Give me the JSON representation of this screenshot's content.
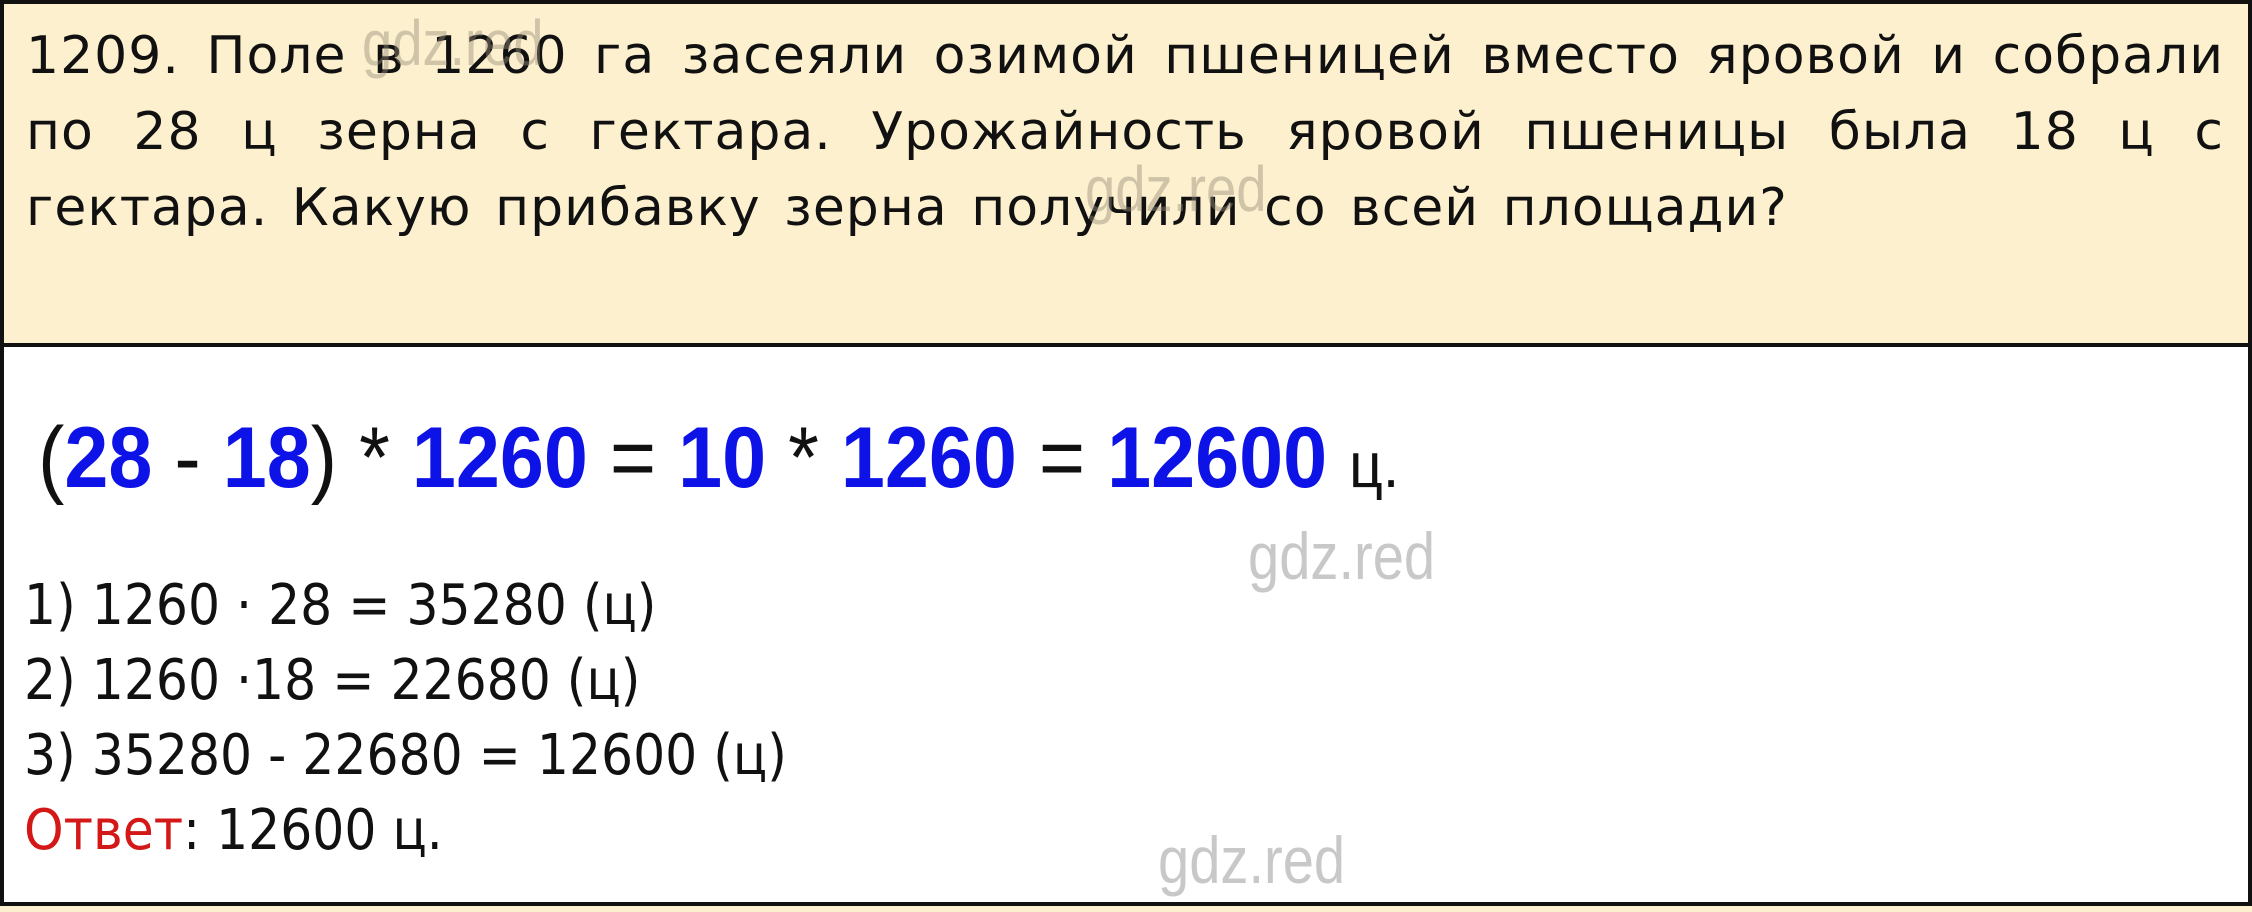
{
  "problem": {
    "number": "1209.",
    "text": "Поле в 1260 га засеяли озимой пшеницей вместо яровой  и собрали по 28 ц зерна с гектара. Урожайность яровой пшеницы была 18 ц с гектара. Какую прибавку зерна получили со всей площади?"
  },
  "equation": {
    "open_paren": "(",
    "a": "28",
    "minus": "-",
    "b": "18",
    "close_paren": ")",
    "times1": "*",
    "c": "1260",
    "eq1": "=",
    "d": "10",
    "times2": "*",
    "e": "1260",
    "eq2": "=",
    "result": "12600",
    "unit": "ц."
  },
  "steps": [
    "1) 1260 · 28 = 35280 (ц)",
    "2) 1260 ·18 = 22680 (ц)",
    "3) 35280 - 22680 = 12600 (ц)"
  ],
  "answer": {
    "label": "Ответ",
    "value": ": 12600 ц."
  },
  "watermarks": [
    "gdz.red",
    "gdz.red",
    "gdz.red",
    "gdz.red"
  ],
  "colors": {
    "problem_bg": "#fdf0cf",
    "number_blue": "#0d12e6",
    "answer_red": "#d41818",
    "watermark_gray": "#c8c8c8"
  }
}
